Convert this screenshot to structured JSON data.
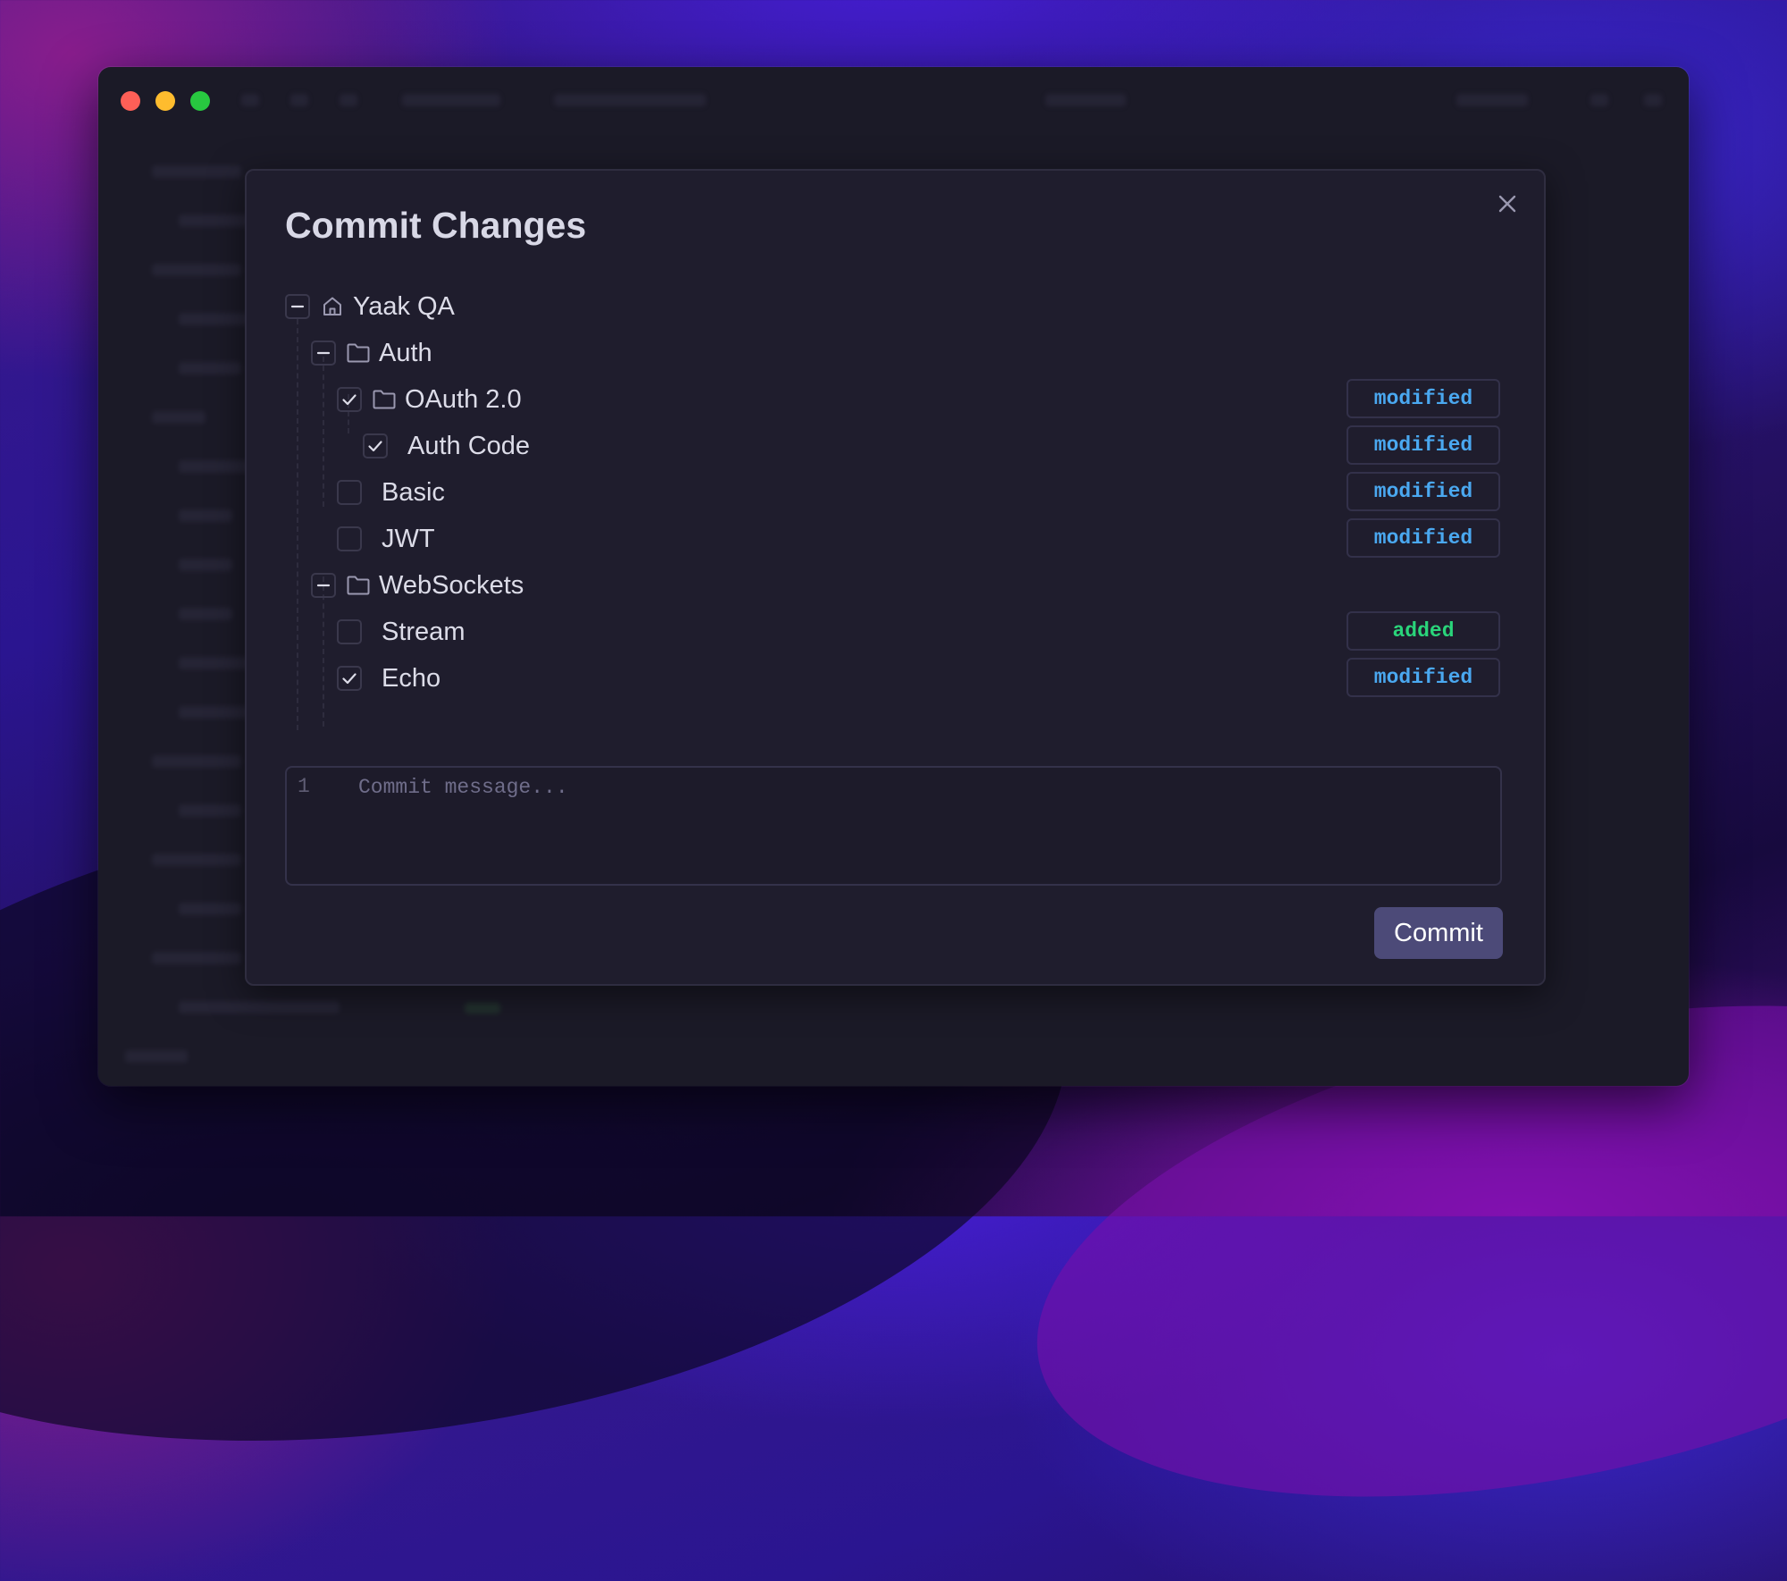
{
  "dialog": {
    "title": "Commit Changes"
  },
  "tree": [
    {
      "label": "Yaak QA",
      "control": "collapse",
      "icon": "home-icon",
      "depth": 0
    },
    {
      "label": "Auth",
      "control": "collapse",
      "icon": "folder-icon",
      "depth": 1
    },
    {
      "label": "OAuth 2.0",
      "control": "checkbox",
      "checked": true,
      "icon": "folder-icon",
      "depth": 2,
      "status": "modified"
    },
    {
      "label": "Auth Code",
      "control": "checkbox",
      "checked": true,
      "icon": null,
      "depth": 3,
      "status": "modified"
    },
    {
      "label": "Basic",
      "control": "checkbox",
      "checked": false,
      "icon": null,
      "depth": 2,
      "status": "modified"
    },
    {
      "label": "JWT",
      "control": "checkbox",
      "checked": false,
      "icon": null,
      "depth": 2,
      "status": "modified"
    },
    {
      "label": "WebSockets",
      "control": "collapse",
      "icon": "folder-icon",
      "depth": 1
    },
    {
      "label": "Stream",
      "control": "checkbox",
      "checked": false,
      "icon": null,
      "depth": 2,
      "status": "added"
    },
    {
      "label": "Echo",
      "control": "checkbox",
      "checked": true,
      "icon": null,
      "depth": 2,
      "status": "modified"
    }
  ],
  "status_colors": {
    "modified": "#4aa8f0",
    "added": "#2ad47a"
  },
  "editor": {
    "line_number": "1",
    "placeholder": "Commit message..."
  },
  "commit_button": {
    "label": "Commit"
  }
}
